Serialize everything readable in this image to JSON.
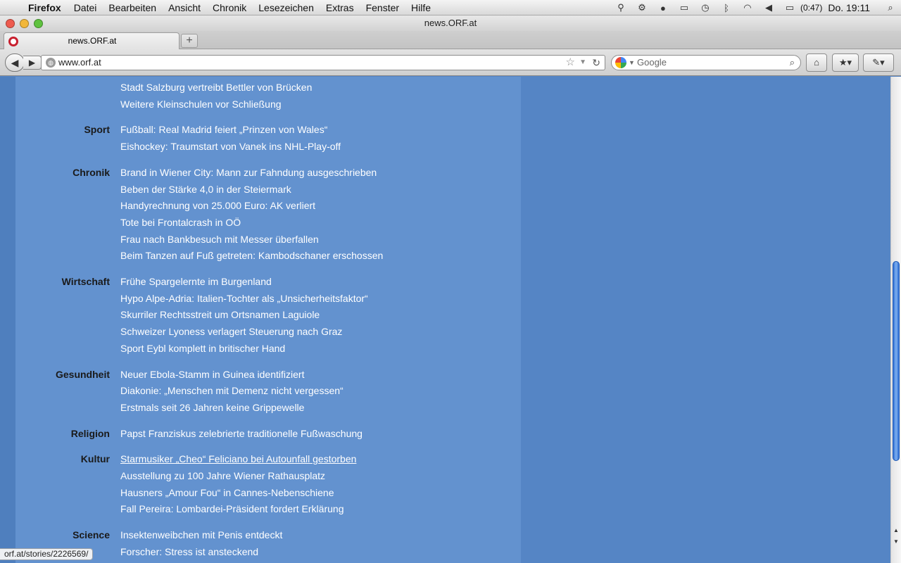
{
  "menubar": {
    "app": "Firefox",
    "menus": [
      "Datei",
      "Bearbeiten",
      "Ansicht",
      "Chronik",
      "Lesezeichen",
      "Extras",
      "Fenster",
      "Hilfe"
    ],
    "battery": "(0:47)",
    "clock": "Do. 19:11"
  },
  "window": {
    "title": "news.ORF.at"
  },
  "tabs": [
    {
      "label": "news.ORF.at"
    }
  ],
  "newtab": "+",
  "navbar": {
    "url": "www.orf.at",
    "search_placeholder": "Google"
  },
  "sections": [
    {
      "label": "",
      "links": [
        "Stadt Salzburg vertreibt Bettler von Brücken",
        "Weitere Kleinschulen vor Schließung"
      ]
    },
    {
      "label": "Sport",
      "links": [
        "Fußball: Real Madrid feiert „Prinzen von Wales“",
        "Eishockey: Traumstart von Vanek ins NHL-Play-off"
      ]
    },
    {
      "label": "Chronik",
      "links": [
        "Brand in Wiener City: Mann zur Fahndung ausgeschrieben",
        "Beben der Stärke 4,0 in der Steiermark",
        "Handyrechnung von 25.000 Euro: AK verliert",
        "Tote bei Frontalcrash in OÖ",
        "Frau nach Bankbesuch mit Messer überfallen",
        "Beim Tanzen auf Fuß getreten: Kambodschaner erschossen"
      ]
    },
    {
      "label": "Wirtschaft",
      "links": [
        "Frühe Spargelernte im Burgenland",
        "Hypo Alpe-Adria: Italien-Tochter als „Unsicherheitsfaktor“",
        "Skurriler Rechtsstreit um Ortsnamen Laguiole",
        "Schweizer Lyoness verlagert Steuerung nach Graz",
        "Sport Eybl komplett in britischer Hand"
      ]
    },
    {
      "label": "Gesundheit",
      "links": [
        "Neuer Ebola-Stamm in Guinea identifiziert",
        "Diakonie: „Menschen mit Demenz nicht vergessen“",
        "Erstmals seit 26 Jahren keine Grippewelle"
      ]
    },
    {
      "label": "Religion",
      "links": [
        "Papst Franziskus zelebrierte traditionelle Fußwaschung"
      ]
    },
    {
      "label": "Kultur",
      "links": [
        "Starmusiker „Cheo“ Feliciano bei Autounfall gestorben",
        "Ausstellung zu 100 Jahre Wiener Rathausplatz",
        "Hausners „Amour Fou“ in Cannes-Nebenschiene",
        "Fall Pereira: Lombardei-Präsident fordert Erklärung"
      ]
    },
    {
      "label": "Science",
      "links": [
        "Insektenweibchen mit Penis entdeckt",
        "Forscher: Stress ist ansteckend"
      ]
    }
  ],
  "hovered_link": "Starmusiker „Cheo“ Feliciano bei Autounfall gestorben",
  "status_url": "orf.at/stories/2226569/"
}
